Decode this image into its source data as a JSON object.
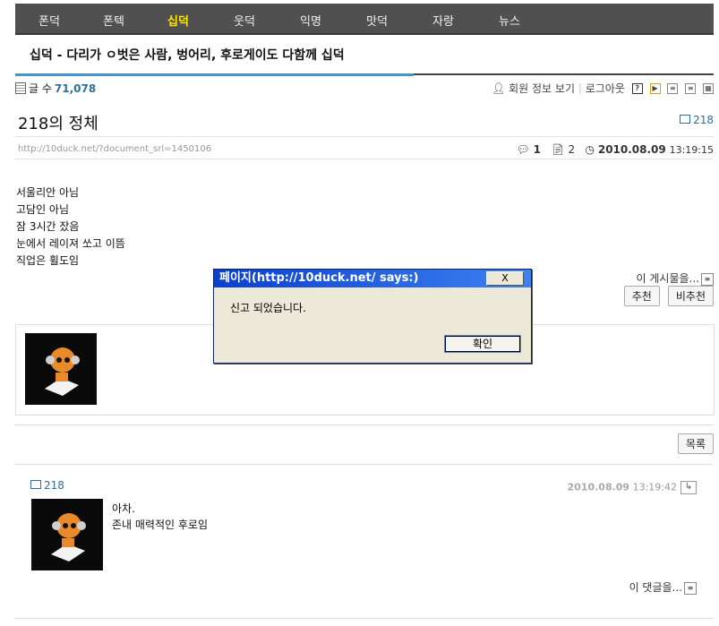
{
  "nav": [
    "폰덕",
    "폰텍",
    "십덕",
    "웃덕",
    "익명",
    "맛덕",
    "자랑",
    "뉴스"
  ],
  "nav_active": "십덕",
  "board": {
    "title": "십덕 - 다리가 ㅇ벗은 사람, 벙어리, 후로게이도 다함께 십덕"
  },
  "topbar": {
    "count_label": "글 수",
    "count": "71,078",
    "member_info": "회원 정보 보기",
    "logout": "로그아웃",
    "help_icon_text": "?"
  },
  "post": {
    "title": "218의 정체",
    "author": "218",
    "url": "http://10duck.net/?document_srl=1450106",
    "comments": "1",
    "trackbacks": "2",
    "date": "2010.08.09",
    "time": "13:19:15",
    "lines": [
      "서울리안 아님",
      "고담인 아님",
      "잠 3시간 잤음",
      "눈에서 레이져 쏘고 이뜸",
      "직업은 휠도임"
    ],
    "report": "이 게시물을...",
    "recommend": "추천",
    "not_recommend": "비추천",
    "list_button": "목록"
  },
  "comment": {
    "author": "218",
    "date": "2010.08.09",
    "time": "13:19:42",
    "lines": [
      "아차.",
      "존내 매력적인 후로임"
    ],
    "report": "이 댓글을...",
    "reply_icon_text": "↳"
  },
  "dialog": {
    "title": "페이지(http://10duck.net/ says:)",
    "close": "X",
    "message": "신고 되었습니다.",
    "ok": "확인"
  },
  "colors": {
    "nav_bg": "#505050",
    "nav_active": "#ffe600",
    "accent_blue": "#4a93c8",
    "link_blue": "#2e6f9e"
  }
}
